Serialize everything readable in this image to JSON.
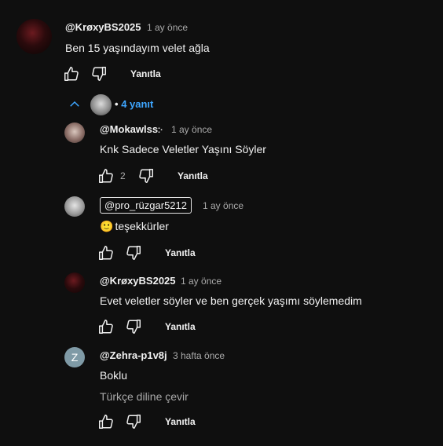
{
  "comment": {
    "author": "@KrøxyBS2025",
    "time": "1 ay önce",
    "text": "Ben 15 yaşındayım velet ağla",
    "reply_label": "Yanıtla"
  },
  "replies_toggle": {
    "bullet": "•",
    "label": "4 yanıt"
  },
  "replies": [
    {
      "author": "@Mokawlss჻",
      "time": "1 ay önce",
      "text": "Knk Sadece Veletler Yaşını Söyler",
      "likes": "2",
      "reply_label": "Yanıtla"
    },
    {
      "author": "@pro_rüzgar5212",
      "time": "1 ay önce",
      "emoji": "🙂",
      "text": "teşekkürler",
      "reply_label": "Yanıtla"
    },
    {
      "author": "@KrøxyBS2025",
      "time": "1 ay önce",
      "text": "Evet veletler söyler ve ben gerçek yaşımı söylemedim",
      "reply_label": "Yanıtla"
    },
    {
      "author": "@Zehra-p1v8j",
      "time": "3 hafta önce",
      "avatar_letter": "Z",
      "text": "Boklu",
      "translate_label": "Türkçe diline çevir",
      "reply_label": "Yanıtla"
    }
  ],
  "colors": {
    "background": "#0f0f0f",
    "link": "#3ea6ff",
    "avatar_z": "#7f9aa6"
  },
  "icons": [
    "thumb-up-icon",
    "thumb-down-icon",
    "chevron-up-icon"
  ]
}
